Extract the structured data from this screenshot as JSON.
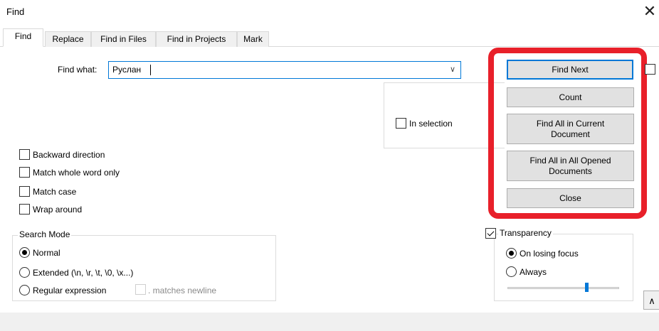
{
  "window": {
    "title": "Find",
    "close_symbol": "✕"
  },
  "tabs": [
    {
      "label": "Find",
      "active": true
    },
    {
      "label": "Replace",
      "active": false
    },
    {
      "label": "Find in Files",
      "active": false
    },
    {
      "label": "Find in Projects",
      "active": false
    },
    {
      "label": "Mark",
      "active": false
    }
  ],
  "find": {
    "label": "Find what:",
    "value": "Руслан",
    "dropdown_symbol": "∨"
  },
  "in_selection": {
    "label": "In selection",
    "checked": false
  },
  "options": [
    {
      "label": "Backward direction",
      "checked": false
    },
    {
      "label": "Match whole word only",
      "checked": false
    },
    {
      "label": "Match case",
      "checked": false
    },
    {
      "label": "Wrap around",
      "checked": false
    }
  ],
  "search_mode": {
    "title": "Search Mode",
    "normal": "Normal",
    "extended": "Extended (\\n, \\r, \\t, \\0, \\x...)",
    "regex": "Regular expression",
    "matches_newline": ". matches newline",
    "selected": "normal"
  },
  "buttons": {
    "find_next": "Find Next",
    "count": "Count",
    "find_all_current": "Find All in Current\nDocument",
    "find_all_opened": "Find All in All Opened\nDocuments",
    "close": "Close"
  },
  "transparency": {
    "label": "Transparency",
    "checked": true,
    "on_losing_focus": "On losing focus",
    "always": "Always",
    "selected": "on_losing_focus",
    "level": 0.7
  },
  "scroll_symbol": "∧",
  "colors": {
    "accent": "#0078d7",
    "highlight_outline": "#e8202a",
    "button_face": "#e1e1e1"
  }
}
